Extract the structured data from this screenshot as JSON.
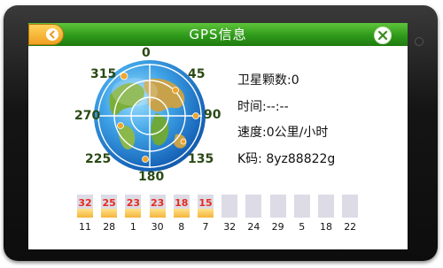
{
  "window": {
    "title": "GPS信息",
    "back_icon": "back-arrow-icon",
    "close_icon": "close-x-icon",
    "accent_color": "#2f9a1a"
  },
  "compass": {
    "labels": {
      "n": "0",
      "ne": "45",
      "e": "90",
      "se": "135",
      "s": "180",
      "sw": "225",
      "w": "270",
      "nw": "315"
    }
  },
  "info": {
    "satellites": "卫星颗数:0",
    "time": "时间:--:--",
    "speed": "速度:0公里/小时",
    "kcode": "K码: 8yz88822g"
  },
  "satellites": [
    {
      "id": "11",
      "snr": "32",
      "level": 0.38
    },
    {
      "id": "28",
      "snr": "25",
      "level": 0.38
    },
    {
      "id": "1",
      "snr": "23",
      "level": 0.38
    },
    {
      "id": "30",
      "snr": "23",
      "level": 0.38
    },
    {
      "id": "8",
      "snr": "18",
      "level": 0.38
    },
    {
      "id": "7",
      "snr": "15",
      "level": 0.38
    },
    {
      "id": "32",
      "snr": "",
      "level": 0
    },
    {
      "id": "24",
      "snr": "",
      "level": 0
    },
    {
      "id": "29",
      "snr": "",
      "level": 0
    },
    {
      "id": "5",
      "snr": "",
      "level": 0
    },
    {
      "id": "18",
      "snr": "",
      "level": 0
    },
    {
      "id": "22",
      "snr": "",
      "level": 0
    }
  ]
}
